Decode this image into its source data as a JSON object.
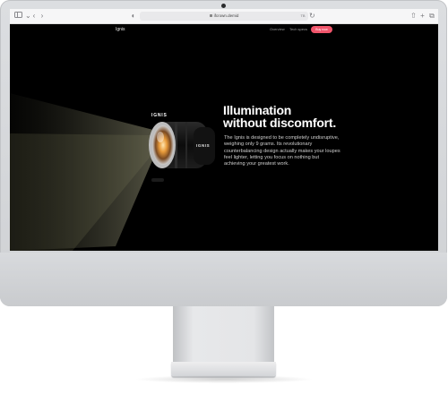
{
  "browser": {
    "url": "ifcrown.demid",
    "badge": "TB"
  },
  "site": {
    "brand": "Ignis",
    "nav": [
      "Overview",
      "Tech specs"
    ],
    "buy_label": "Buy now"
  },
  "hero": {
    "product_mark": "IGNIS",
    "title_line1": "Illumination",
    "title_line2": "without discomfort.",
    "description": "The Ignis is designed to be completely undisruptive, weighing only 9 grams. Its revolutionary counterbalancing design actually makes your loupes feel lighter, letting you focus on nothing but achieving your greatest work."
  },
  "icons": {
    "sidebar": "sidebar-icon",
    "back": "chevron-left-icon",
    "forward": "chevron-right-icon",
    "privacy": "shield-icon",
    "share": "share-icon",
    "new_tab": "plus-icon",
    "tabs": "tabs-icon"
  },
  "colors": {
    "accent": "#f0556b",
    "screen_bg": "#000000",
    "device": "#d5d7da"
  }
}
